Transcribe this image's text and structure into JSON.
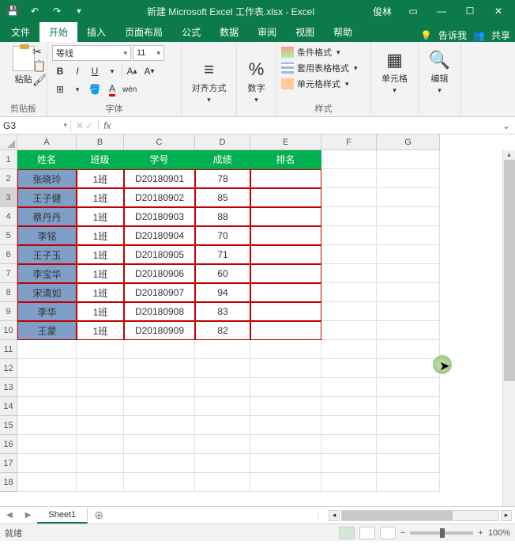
{
  "titlebar": {
    "title": "新建 Microsoft Excel 工作表.xlsx - Excel",
    "user": "俊林"
  },
  "tabs": {
    "file": "文件",
    "home": "开始",
    "insert": "插入",
    "layout": "页面布局",
    "formulas": "公式",
    "data": "数据",
    "review": "审阅",
    "view": "视图",
    "help": "帮助",
    "tell": "告诉我",
    "share": "共享"
  },
  "ribbon": {
    "groups": {
      "clipboard": "剪贴板",
      "font": "字体",
      "alignment": "对齐方式",
      "number": "数字",
      "styles": "样式",
      "cells": "单元格",
      "editing": "编辑"
    },
    "paste": "粘贴",
    "font_name": "等线",
    "font_size": "11",
    "cond_fmt": "条件格式",
    "tbl_fmt": "套用表格格式",
    "cell_style": "单元格样式"
  },
  "namebox": "G3",
  "sheet": {
    "cols": [
      {
        "l": "A",
        "w": 75
      },
      {
        "l": "B",
        "w": 60
      },
      {
        "l": "C",
        "w": 90
      },
      {
        "l": "D",
        "w": 70
      },
      {
        "l": "E",
        "w": 90
      },
      {
        "l": "F",
        "w": 70
      },
      {
        "l": "G",
        "w": 80
      }
    ],
    "headers": [
      "姓名",
      "班级",
      "学号",
      "成绩",
      "排名"
    ],
    "rows": [
      {
        "name": "张晓玲",
        "cls": "1班",
        "id": "D20180901",
        "score": "78"
      },
      {
        "name": "王子健",
        "cls": "1班",
        "id": "D20180902",
        "score": "85"
      },
      {
        "name": "蔡丹丹",
        "cls": "1班",
        "id": "D20180903",
        "score": "88"
      },
      {
        "name": "李铭",
        "cls": "1班",
        "id": "D20180904",
        "score": "70"
      },
      {
        "name": "王子玉",
        "cls": "1班",
        "id": "D20180905",
        "score": "71"
      },
      {
        "name": "李宝华",
        "cls": "1班",
        "id": "D20180906",
        "score": "60"
      },
      {
        "name": "宋清如",
        "cls": "1班",
        "id": "D20180907",
        "score": "94"
      },
      {
        "name": "李华",
        "cls": "1班",
        "id": "D20180908",
        "score": "83"
      },
      {
        "name": "王蒙",
        "cls": "1班",
        "id": "D20180909",
        "score": "82"
      }
    ],
    "visible_rows": 18
  },
  "sheettab": "Sheet1",
  "status": {
    "ready": "就绪",
    "zoom": "100%"
  }
}
